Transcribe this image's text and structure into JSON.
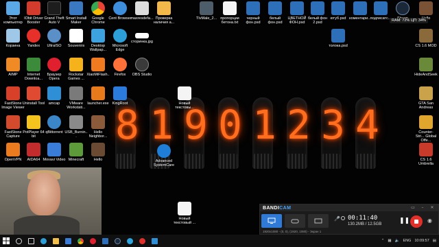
{
  "desktop": {
    "icons": [
      {
        "label": "Этот компьютер",
        "color": "#5aa9e6"
      },
      {
        "label": "IObit Driver Booster",
        "color": "#d33b2c"
      },
      {
        "label": "Grand Theft Auto V",
        "color": "#1d1d1d"
      },
      {
        "label": "Smart Install Maker",
        "color": "#3a78c2"
      },
      {
        "label": "Google Chrome",
        "color": "#ea4335"
      },
      {
        "label": "Cent Browser",
        "color": "#3d8edc"
      },
      {
        "label": "maxresdefa...",
        "color": "#dddddd"
      },
      {
        "label": "Проверка наличия а...",
        "color": "#f2b84a"
      },
      {
        "label": "Корзина",
        "color": "#9ec7e8"
      },
      {
        "label": "Yandex",
        "color": "#e8302a"
      },
      {
        "label": "UltraISO",
        "color": "#5b8fc8"
      },
      {
        "label": "Souvenirs",
        "color": "#ffffff"
      },
      {
        "label": "Desktop Wallpap...",
        "color": "#3ca2e0"
      },
      {
        "label": "Microsoft Edge",
        "color": "#2d9fd8"
      },
      {
        "label": "сторинка.jpg",
        "color": "#ffffff"
      },
      {
        "label": "AIMP",
        "color": "#f08a24"
      },
      {
        "label": "Internet Downloa...",
        "color": "#3b8b3a"
      },
      {
        "label": "Браузер Opera",
        "color": "#e0202e"
      },
      {
        "label": "Rockstar Games ...",
        "color": "#f6b21b"
      },
      {
        "label": "XiaoMiFlash...",
        "color": "#f07a20"
      },
      {
        "label": "Firefox",
        "color": "#ff7139"
      },
      {
        "label": "OBS Studio",
        "color": "#3a3a3a"
      },
      {
        "label": "FastStone Image Viewer",
        "color": "#d8402a"
      },
      {
        "label": "Uninstall Tool",
        "color": "#e04a30"
      },
      {
        "label": "amcap",
        "color": "#2f8fd6"
      },
      {
        "label": "VMware Workstati...",
        "color": "#7a7a7a"
      },
      {
        "label": "launcher.exe",
        "color": "#e87a1c"
      },
      {
        "label": "KingRoot",
        "color": "#2b7bdc"
      },
      {
        "label": "Новый текстовы...",
        "color": "#f4f4f4"
      },
      {
        "label": "FastStone Capture",
        "color": "#d34a2c"
      },
      {
        "label": "PotPlayer 64 bit",
        "color": "#f4c31e"
      },
      {
        "label": "qBittorrent",
        "color": "#3b86c9"
      },
      {
        "label": "USB_Burnin...",
        "color": "#8a8a8a"
      },
      {
        "label": "Hello Neighbor...",
        "color": "#8a5a3a"
      },
      {
        "label": "OpenVPN",
        "color": "#ea7b1f"
      },
      {
        "label": "AIDA64",
        "color": "#c22c2c"
      },
      {
        "label": "Movavi Video",
        "color": "#3a7dd8"
      },
      {
        "label": "Minecraft",
        "color": "#5c9a3a"
      },
      {
        "label": "Hello",
        "color": "#6a4a32"
      },
      {
        "label": "Advanced SystemCare",
        "color": "#1f7fd8"
      },
      {
        "label": "Новый текстовый ...",
        "color": "#f4f4f4"
      },
      {
        "label": "TIvMale_2...",
        "color": "#4d5d6a"
      },
      {
        "label": "пропорции бетона.txt",
        "color": "#f4f4f4"
      },
      {
        "label": "черный фон.psd",
        "color": "#2d6fb8"
      },
      {
        "label": "белый фон.psd",
        "color": "#2d6fb8"
      },
      {
        "label": "ЦВЕТНОЙ ФОН.psd",
        "color": "#2d6fb8"
      },
      {
        "label": "белый фон 2.psd",
        "color": "#2d6fb8"
      },
      {
        "label": "ютуб.psd",
        "color": "#2d6fb8"
      },
      {
        "label": "коментари...",
        "color": "#2d6fb8"
      },
      {
        "label": "подписатс...",
        "color": "#2d6fb8"
      },
      {
        "label": "Steam",
        "color": "#1b2838"
      },
      {
        "label": "Hello",
        "color": "#7a5236"
      },
      {
        "label": "толока.psd",
        "color": "#2d6fb8"
      },
      {
        "label": "CS 1.6 MOD",
        "color": "#8a6a3a"
      },
      {
        "label": "HideAndSeek",
        "color": "#6a8a3a"
      },
      {
        "label": "GTA San Andreas",
        "color": "#caa24a"
      },
      {
        "label": "Counter-Stri... Global Offe...",
        "color": "#e0a52c"
      },
      {
        "label": "CS 1.6 Umbrella",
        "color": "#c83a2a"
      }
    ]
  },
  "nixie": {
    "digits": [
      "8",
      "1",
      "9",
      "0",
      "1",
      "2",
      "3",
      "4"
    ]
  },
  "ram": {
    "text": "RAM: 72%  ЦП: 34%"
  },
  "bandicam": {
    "logo_main": "BANDI",
    "logo_accent": "CAM",
    "timer": "00:11:40",
    "size": "130.2MB / 12.5GB",
    "status": "1920x1080 - (0, 0), (1920, 1080) - Экран 1",
    "pause": "❚❚"
  },
  "taskbar": {
    "lang": "ENG",
    "time": "10:09:57",
    "date": ""
  }
}
